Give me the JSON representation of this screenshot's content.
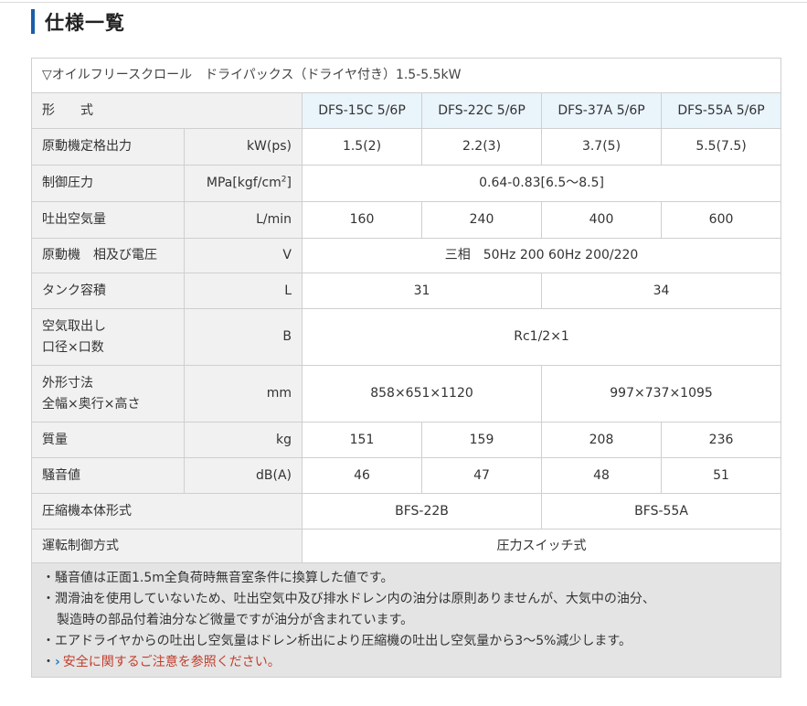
{
  "page": {
    "heading": "仕様一覧"
  },
  "table": {
    "caption": "▽オイルフリースクロール　ドライパックス（ドライヤ付き）1.5-5.5kW",
    "model_header": "形　　式",
    "models": [
      "DFS-15C 5/6P",
      "DFS-22C 5/6P",
      "DFS-37A 5/6P",
      "DFS-55A 5/6P"
    ],
    "rows": {
      "output": {
        "label": "原動機定格出力",
        "unit": "kW(ps)",
        "values": [
          "1.5(2)",
          "2.2(3)",
          "3.7(5)",
          "5.5(7.5)"
        ]
      },
      "pressure": {
        "label": "制御圧力",
        "unit_main": "MPa[kgf/cm",
        "unit_sup": "2",
        "unit_end": "]",
        "value": "0.64-0.83[6.5〜8.5]"
      },
      "air_delivery": {
        "label": "吐出空気量",
        "unit": "L/min",
        "values": [
          "160",
          "240",
          "400",
          "600"
        ]
      },
      "motor": {
        "label": "原動機　相及び電圧",
        "unit": "V",
        "value": "三相　50Hz 200 60Hz 200/220"
      },
      "tank": {
        "label": "タンク容積",
        "unit": "L",
        "values": [
          "31",
          "34"
        ]
      },
      "outlet": {
        "label_line1": "空気取出し",
        "label_line2": "口径×口数",
        "unit": "B",
        "value": "Rc1/2×1"
      },
      "dimensions": {
        "label_line1": "外形寸法",
        "label_line2": "全幅×奥行×高さ",
        "unit": "mm",
        "values": [
          "858×651×1120",
          "997×737×1095"
        ]
      },
      "mass": {
        "label": "質量",
        "unit": "kg",
        "values": [
          "151",
          "159",
          "208",
          "236"
        ]
      },
      "noise": {
        "label": "騒音値",
        "unit": "dB(A)",
        "values": [
          "46",
          "47",
          "48",
          "51"
        ]
      },
      "compressor": {
        "label": "圧縮機本体形式",
        "values": [
          "BFS-22B",
          "BFS-55A"
        ]
      },
      "control": {
        "label": "運転制御方式",
        "value": "圧力スイッチ式"
      }
    },
    "notes": {
      "line1": "・騒音値は正面1.5m全負荷時無音室条件に換算した値です。",
      "line2": "・潤滑油を使用していないため、吐出空気中及び排水ドレン内の油分は原則ありませんが、大気中の油分、",
      "line3": "製造時の部品付着油分など微量ですが油分が含まれています。",
      "line4": "・エアドライヤからの吐出し空気量はドレン析出により圧縮機の吐出し空気量から3〜5%減少します。",
      "link_bullet": "・",
      "link_chevron": "›",
      "link_text": "安全に関するご注意を参照ください。"
    },
    "colors": {
      "heading_bar": "#1a5ea8",
      "model_header_bg": "#eaf4fb",
      "label_bg": "#f1f1f1",
      "notes_bg": "#e4e4e4",
      "link_text": "#c23e2c",
      "link_chevron": "#1b7bd0"
    }
  }
}
